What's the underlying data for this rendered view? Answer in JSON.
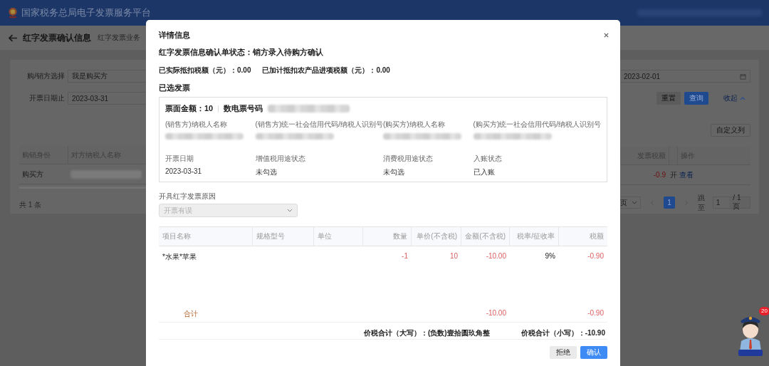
{
  "header": {
    "title": "国家税务总局电子发票服务平台"
  },
  "page": {
    "title": "红字发票确认信息",
    "breadcrumb": [
      "红字发票业务"
    ]
  },
  "filters": [
    {
      "label": "购/销方选择",
      "value": "我是购买方"
    },
    {
      "label": "开票日期止",
      "value": "2023-03-31"
    }
  ],
  "filter_field_3": {
    "value": "2023-02-01"
  },
  "filter_buttons": [
    {
      "label": "重置",
      "kind": "plain"
    },
    {
      "label": "查询",
      "kind": "primary"
    },
    {
      "label": "收起",
      "kind": "link"
    }
  ],
  "column_button": "自定义列",
  "table": {
    "columns_left": [
      "购销身份",
      "对方纳税人名称"
    ],
    "columns_right": [
      "发票税额",
      "操作"
    ],
    "rows": [
      {
        "role": "购买方",
        "tax": "-0.9",
        "column_3": "开",
        "action": "查看"
      }
    ]
  },
  "total": "共 1 条",
  "pagination": {
    "size_suffix": "页",
    "current": "1",
    "jump_label": "跳至",
    "jump_value": "1",
    "total_pages": "/ 1 页"
  },
  "modal": {
    "title": "详情信息",
    "status": "红字发票信息确认单状态：销方录入待购方确认",
    "amounts": [
      "已实际抵扣税额（元）：0.00",
      "已加计抵扣农产品进项税额（元）：0.00"
    ],
    "section": "已选发票",
    "invoice": {
      "face_amount": "票面金额：10",
      "number_label": "数电票号码",
      "fields": [
        {
          "label": "(销售方)纳税人名称"
        },
        {
          "label": "(销售方)统一社会信用代码/纳税人识别号"
        },
        {
          "label": "(购买方)纳税人名称"
        },
        {
          "label": "(购买方)统一社会信用代码/纳税人识别号"
        },
        {
          "label": "开票日期",
          "value": "2023-03-31"
        },
        {
          "label": "增值税用途状态",
          "value": "未勾选"
        },
        {
          "label": "消费税用途状态",
          "value": "未勾选"
        },
        {
          "label": "入账状态",
          "value": "已入账"
        }
      ]
    },
    "reason_label": "开具红字发票原因",
    "reason": {
      "value": "开票有误",
      "disabled": true
    },
    "items": {
      "columns": [
        "项目名称",
        "规格型号",
        "单位",
        "数量",
        "单价(不含税)",
        "金额(不含税)",
        "税率/征收率",
        "税额"
      ],
      "rows": [
        {
          "cells": [
            "*水果*苹果",
            "",
            "",
            "-1",
            "10",
            "-10.00",
            "9%",
            "-0.90"
          ]
        }
      ],
      "total_label": "合计",
      "total_amount": "-10.00",
      "total_tax": "-0.90"
    },
    "sum_upper": "价税合计（大写）：(负数)壹拾圆玖角整",
    "sum_lower": "价税合计（小写）：-10.90",
    "buttons": [
      {
        "label": "拒绝",
        "kind": "plain"
      },
      {
        "label": "确认",
        "kind": "primary"
      }
    ]
  },
  "assistant": {
    "badge": "20"
  }
}
